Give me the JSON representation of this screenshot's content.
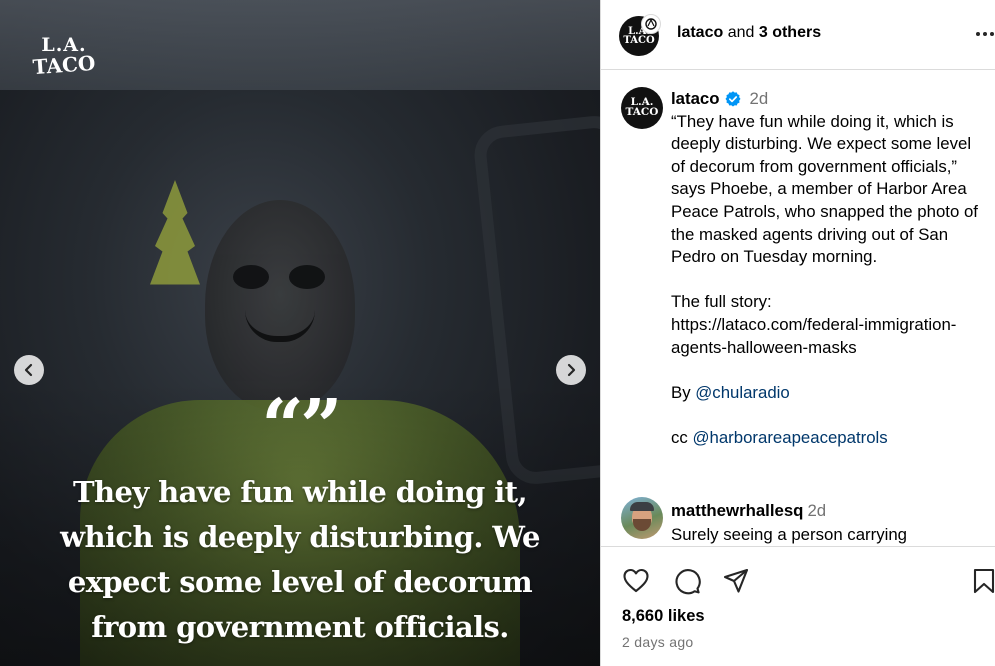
{
  "media": {
    "logo_line1": "L.A.",
    "logo_line2": "TACO",
    "quote_mark": "“”",
    "quote_text": "They have fun while doing it, which is deeply disturbing. We expect some level of decorum from government officials."
  },
  "header": {
    "username": "lataco",
    "connector": "and",
    "others": "3 others",
    "avatar_line1": "L.A.",
    "avatar_line2": "TACO"
  },
  "post": {
    "username": "lataco",
    "time": "2d",
    "avatar_line1": "L.A.",
    "avatar_line2": "TACO",
    "caption_quote": "“They have fun while doing it, which is deeply disturbing. We expect some level of decorum from government officials,” says Phoebe, a member of Harbor Area Peace Patrols, who snapped the photo of the masked agents driving out of San Pedro on Tuesday morning.",
    "story_label": "The full story:",
    "story_url": "https://lataco.com/federal-immigration-agents-halloween-masks",
    "by_prefix": "By",
    "by_mention": "@chularadio",
    "cc_prefix": "cc",
    "cc_mention": "@harborareapeacepatrols"
  },
  "comment": {
    "username": "matthewrhallesq",
    "time": "2d",
    "text": "Surely seeing a person carrying"
  },
  "footer": {
    "likes": "8,660 likes",
    "date": "2 days ago"
  },
  "colors": {
    "link": "#00376b",
    "muted": "#737373",
    "verified": "#0095f6",
    "border": "#dbdbdb"
  },
  "icons": [
    "chevron-left-icon",
    "chevron-right-icon",
    "more-icon",
    "verified-icon",
    "heart-icon",
    "comment-icon",
    "share-icon",
    "bookmark-icon",
    "collab-icon"
  ]
}
